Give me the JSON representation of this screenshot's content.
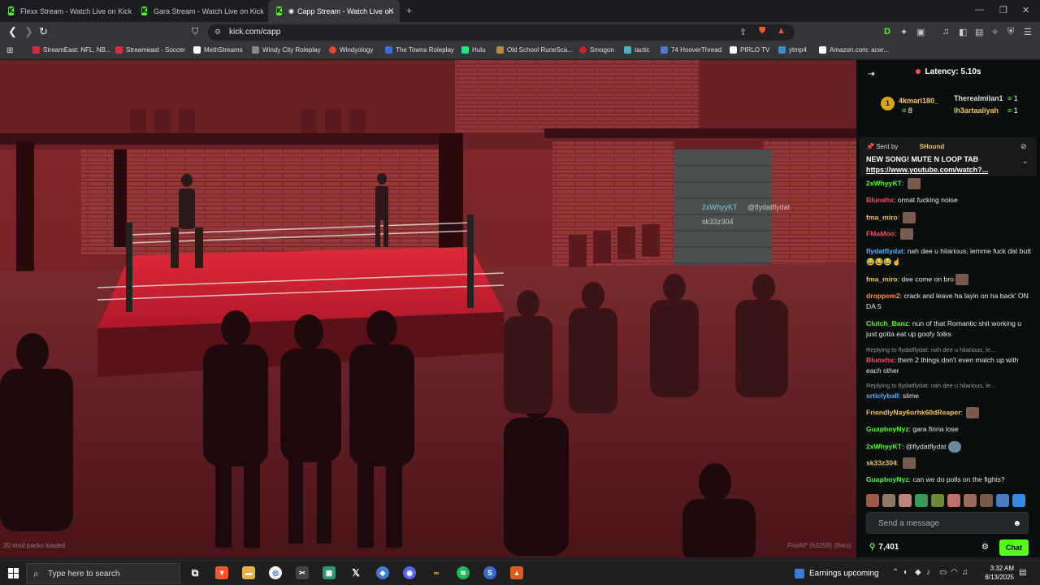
{
  "tabs": [
    {
      "title": "Flexx Stream - Watch Live on Kick",
      "active": false
    },
    {
      "title": "Gara Stream - Watch Live on Kick",
      "active": false
    },
    {
      "title": "Capp Stream - Watch Live on",
      "active": true
    }
  ],
  "address": {
    "url": "kick.com/capp"
  },
  "bookmarks": [
    "StreamEast: NFL, NB...",
    "Streameast - Soccer",
    "MethStreams",
    "Windy City Roleplay",
    "Windyology",
    "The Towns Roleplay",
    "Hulu",
    "Old School RuneSca...",
    "Smogon",
    "tactic",
    "74 HooverThread",
    "PIRLO TV",
    "ytmp4",
    "Amazon.com: acer..."
  ],
  "video": {
    "nametags": [
      "2xWhyyKT",
      "@flydatflydat",
      "sk33z304"
    ],
    "fivem_label": "FiveM* (b3258) (Beta)",
    "hud_text": "20 mod packs loaded"
  },
  "chat": {
    "latency": "Latency: 5.10s",
    "leaderboard": [
      {
        "rank": "1",
        "name": "4kmari180_",
        "count": "8"
      },
      {
        "name": "Therealmilan1",
        "count": "1"
      },
      {
        "name": "lh3artaaliyah",
        "count": "1"
      }
    ],
    "pinned": {
      "sent_by": "Sent by",
      "sender": "SHound",
      "text": "NEW SONG! MUTE N LOOP TAB",
      "link": "https://www.youtube.com/watch?..."
    },
    "messages": [
      {
        "user": "2xWhyyKT",
        "color": "#53fc18",
        "text": ""
      },
      {
        "user": "Blunxhx",
        "color": "#ff4a5a",
        "text": "onnat fucking noise"
      },
      {
        "user": "fma_miro",
        "color": "#f3c546",
        "text": ""
      },
      {
        "user": "FMaMoo",
        "color": "#ff4a5a",
        "text": ""
      },
      {
        "user": "flydatflydat",
        "color": "#4ab3ff",
        "text": "nah dee u hilarious, lemme fuck dat butt 😂😂😂☝"
      },
      {
        "user": "fma_miro",
        "color": "#f3c546",
        "text": "dee come on bro"
      },
      {
        "user": "droppem2",
        "color": "#ff8a3d",
        "text": "crack and leave ha layin on ha back' ON DA 5"
      },
      {
        "user": "Clutch_Banz",
        "color": "#53fc18",
        "text": "nun of that Romantic shit working u just gotta eat up goofy folks"
      },
      {
        "user": "Blunxhx",
        "color": "#ff4a5a",
        "text": "them 2 things don't even match up with each other",
        "reply": "Replying to flydatflydat: nah dee u hilarious, le..."
      },
      {
        "user": "srticlyball",
        "color": "#4ab3ff",
        "text": "slime",
        "reply": "Replying to flydatflydat: nah dee u hilarious, le..."
      },
      {
        "user": "FriendlyNay6orhk60dReaper",
        "color": "#f3c546",
        "text": ""
      },
      {
        "user": "GuapboyNyz",
        "color": "#53fc18",
        "text": "gara finna lose"
      },
      {
        "user": "2xWhyyKT",
        "color": "#53fc18",
        "text": "@flydatflydat"
      },
      {
        "user": "sk33z304",
        "color": "#f3c546",
        "text": ""
      },
      {
        "user": "GuapboyNyz",
        "color": "#53fc18",
        "text": "can we do polls on the fights?"
      }
    ],
    "input_placeholder": "Send a message",
    "viewers": "7,401",
    "chat_button": "Chat"
  },
  "taskbar": {
    "search_placeholder": "Type here to search",
    "earnings": "Earnings upcoming",
    "time": "3:32 AM",
    "date": "8/13/2025"
  }
}
